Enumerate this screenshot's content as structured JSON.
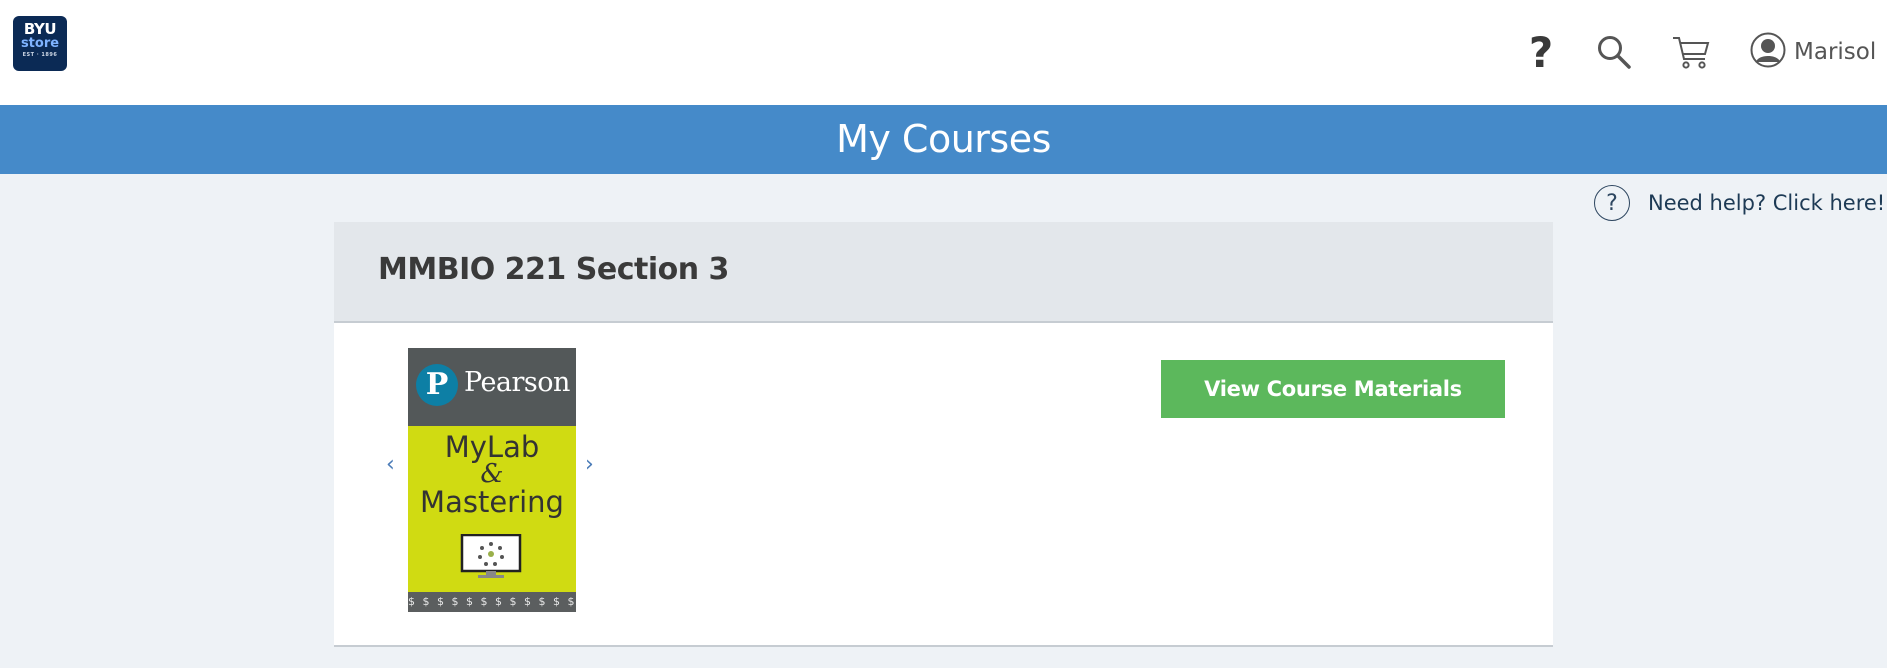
{
  "header": {
    "logo": {
      "line1": "BYU",
      "line2": "store",
      "line3": "EST · 1896"
    },
    "help_icon_glyph": "?",
    "search_icon": "search-icon",
    "cart_icon": "cart-icon",
    "user": {
      "avatar_icon": "user-avatar-icon",
      "name": "Marisol"
    }
  },
  "banner": {
    "title": "My Courses",
    "color": "#458ac9"
  },
  "help_link": {
    "icon_glyph": "?",
    "label": "Need help? Click here!"
  },
  "course": {
    "title": "MMBIO 221 Section 3",
    "carousel": {
      "prev_glyph": "‹",
      "next_glyph": "›"
    },
    "cover": {
      "publisher_mark": "P",
      "publisher": "Pearson",
      "line1": "MyLab",
      "ampersand": "&",
      "line2": "Mastering",
      "band_pattern": "$ $ $ $ $ $ $ $ $ $ $ $ $ $ $"
    },
    "action_button": {
      "label": "View Course Materials",
      "color": "#5cb85c"
    }
  }
}
